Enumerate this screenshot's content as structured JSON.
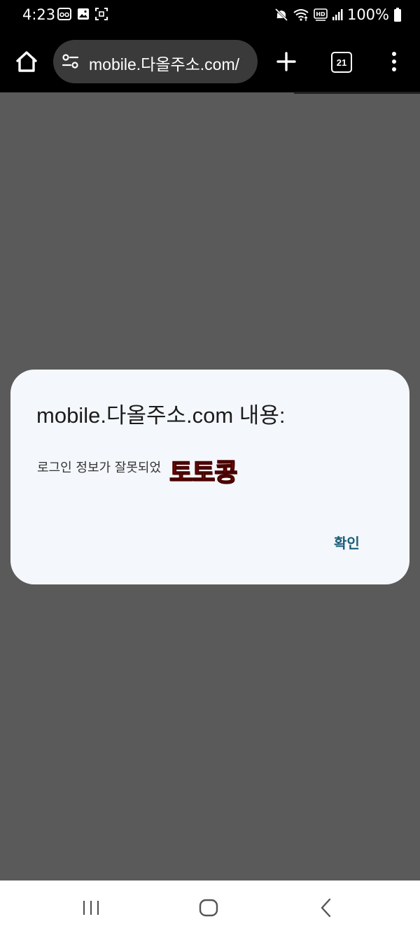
{
  "status_bar": {
    "time": "4:23",
    "battery": "100%",
    "left_icons": [
      "glasses-icon",
      "image-icon",
      "screenshot-icon"
    ],
    "right_icons": [
      "mute-icon",
      "wifi-icon",
      "hd-icon",
      "signal-icon",
      "battery-icon"
    ]
  },
  "browser": {
    "url": "mobile.다올주소.com/",
    "tab_count": "21"
  },
  "dialog": {
    "title": "mobile.다올주소.com 내용:",
    "message": "로그인 정보가 잘못되었",
    "ok_label": "확인"
  },
  "watermark": {
    "text": "토토콩",
    "color": "#e02020"
  },
  "colors": {
    "backdrop": "#5a5a5a",
    "dialog_bg": "#f4f7fb",
    "accent": "#1a5e78"
  }
}
